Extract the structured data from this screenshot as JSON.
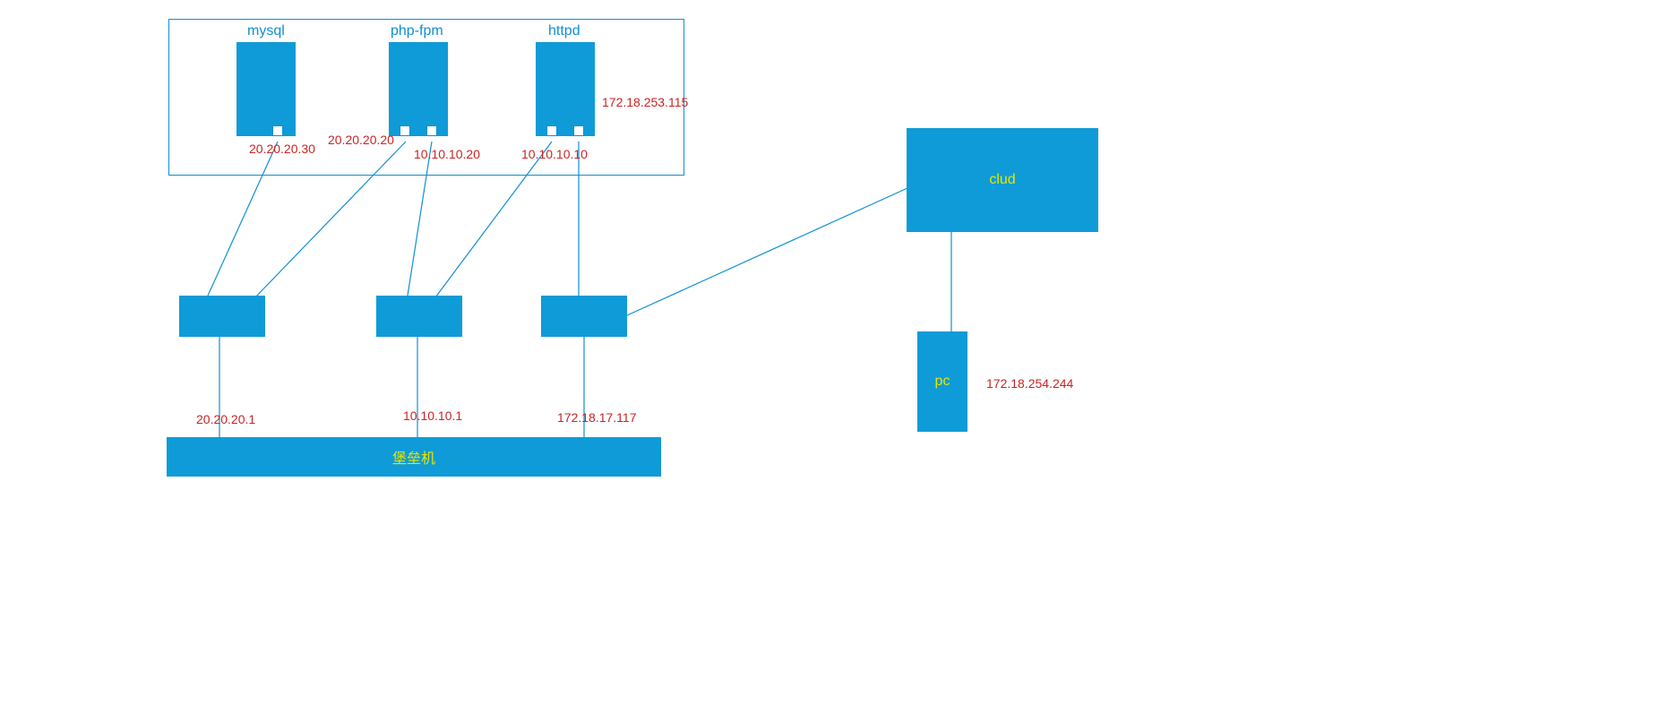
{
  "servers": {
    "mysql": {
      "name": "mysql",
      "ip1": "20.20.20.30"
    },
    "phpfpm": {
      "name": "php-fpm",
      "ip1": "20.20.20.20",
      "ip2": "10.10.10.20"
    },
    "httpd": {
      "name": "httpd",
      "ip1": "172.18.253.115",
      "ip2": "10.10.10.10"
    }
  },
  "bastion": {
    "name": "堡垒机",
    "ip_left": "20.20.20.1",
    "ip_mid": "10.10.10.1",
    "ip_right": "172.18.17.117"
  },
  "cloud": {
    "name": "clud"
  },
  "pc": {
    "name": "pc",
    "ip": "172.18.254.244"
  }
}
